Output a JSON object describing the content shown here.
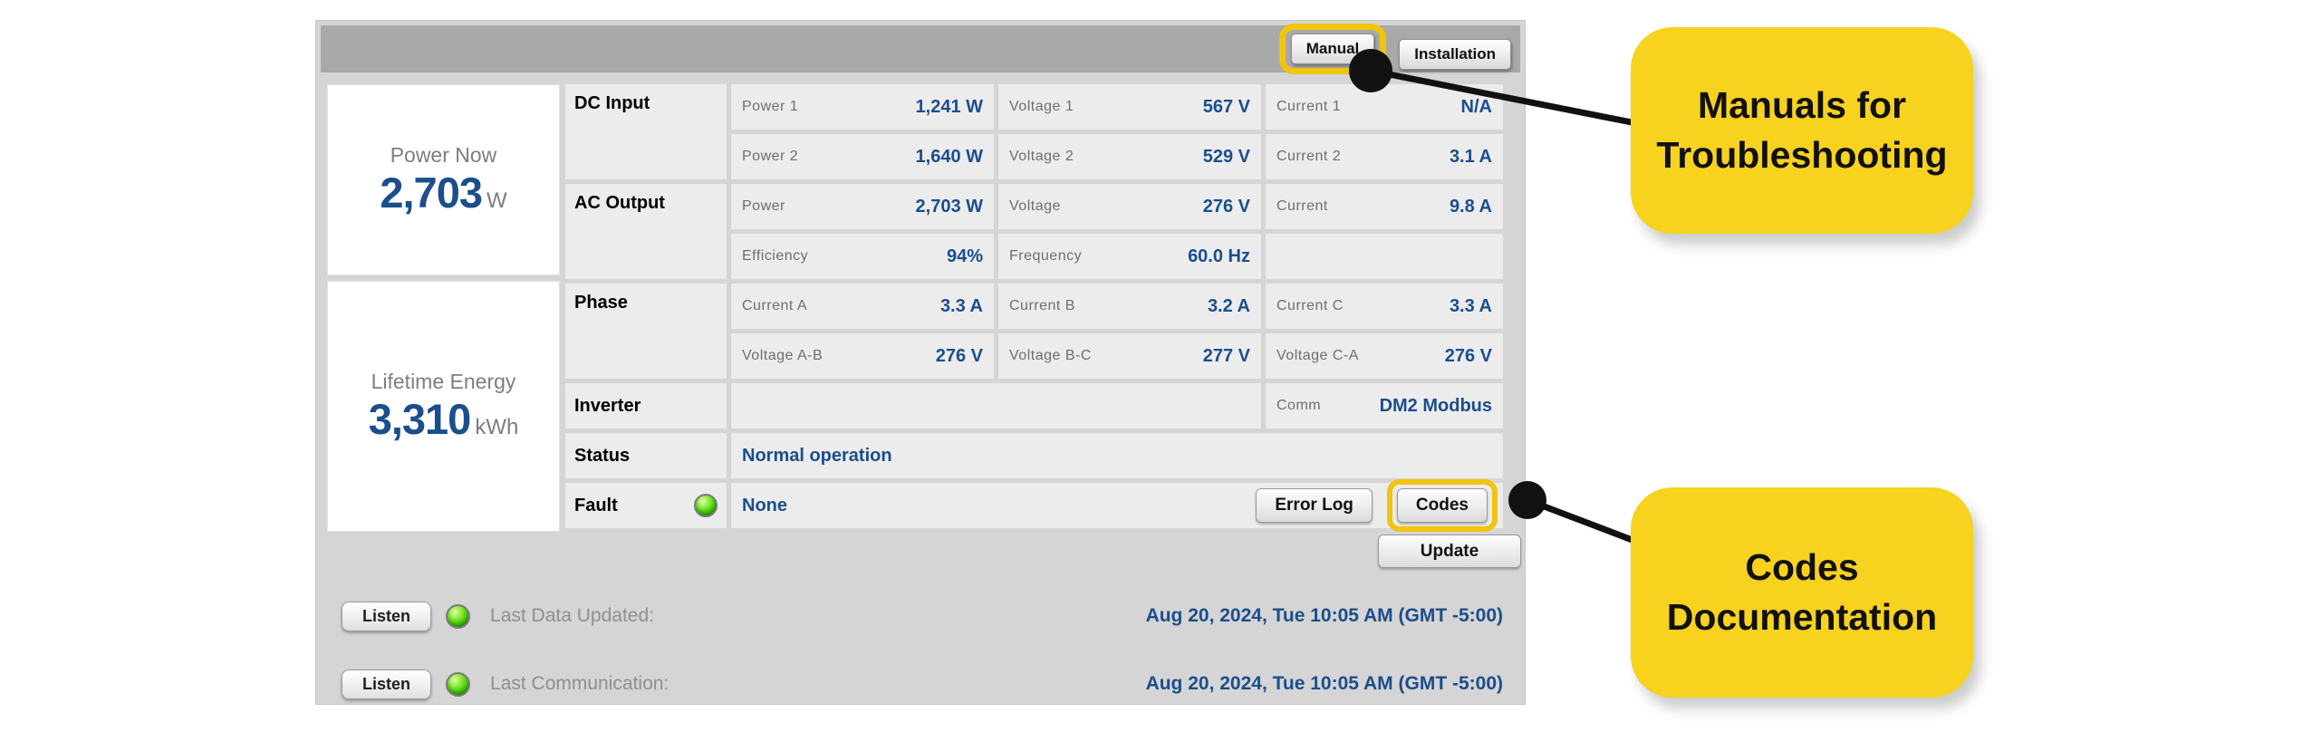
{
  "header": {
    "manual_label": "Manual",
    "installation_label": "Installation"
  },
  "summary": {
    "power_now": {
      "label": "Power Now",
      "value": "2,703",
      "unit": "W"
    },
    "lifetime_energy": {
      "label": "Lifetime Energy",
      "value": "3,310",
      "unit": "kWh"
    }
  },
  "table": {
    "row_labels": {
      "dc": "DC Input",
      "ac": "AC Output",
      "phase": "Phase",
      "inverter": "Inverter",
      "status": "Status",
      "fault": "Fault"
    },
    "cells": {
      "power1": {
        "label": "Power 1",
        "value": "1,241 W"
      },
      "voltage1": {
        "label": "Voltage 1",
        "value": "567 V"
      },
      "current1": {
        "label": "Current 1",
        "value": "N/A"
      },
      "power2": {
        "label": "Power 2",
        "value": "1,640 W"
      },
      "voltage2": {
        "label": "Voltage 2",
        "value": "529 V"
      },
      "current2": {
        "label": "Current 2",
        "value": "3.1 A"
      },
      "ac_power": {
        "label": "Power",
        "value": "2,703 W"
      },
      "ac_voltage": {
        "label": "Voltage",
        "value": "276 V"
      },
      "ac_current": {
        "label": "Current",
        "value": "9.8 A"
      },
      "efficiency": {
        "label": "Efficiency",
        "value": "94%"
      },
      "frequency": {
        "label": "Frequency",
        "value": "60.0 Hz"
      },
      "current_a": {
        "label": "Current A",
        "value": "3.3 A"
      },
      "current_b": {
        "label": "Current B",
        "value": "3.2 A"
      },
      "current_c": {
        "label": "Current C",
        "value": "3.3 A"
      },
      "voltage_ab": {
        "label": "Voltage A-B",
        "value": "276 V"
      },
      "voltage_bc": {
        "label": "Voltage B-C",
        "value": "277 V"
      },
      "voltage_ca": {
        "label": "Voltage C-A",
        "value": "276 V"
      },
      "comm": {
        "label": "Comm",
        "value": "DM2 Modbus"
      }
    },
    "status_value": "Normal operation",
    "fault_value": "None",
    "error_log_label": "Error Log",
    "codes_label": "Codes"
  },
  "footer": {
    "update_label": "Update",
    "listen_label": "Listen",
    "last_data_label": "Last Data Updated:",
    "last_data_value": "Aug 20, 2024, Tue 10:05 AM (GMT -5:00)",
    "last_comm_label": "Last Communication:",
    "last_comm_value": "Aug 20, 2024, Tue 10:05 AM (GMT -5:00)"
  },
  "annotations": {
    "manual_callout_line1": "Manuals for",
    "manual_callout_line2": "Troubleshooting",
    "codes_callout_line1": "Codes",
    "codes_callout_line2": "Documentation"
  },
  "colors": {
    "accent_blue": "#1b4e8c",
    "highlight_yellow": "#f1c40e",
    "callout_yellow": "#f7d21e",
    "led_green": "#3ec700",
    "panel_grey": "#d5d5d5",
    "topbar_grey": "#a9a9a9"
  }
}
